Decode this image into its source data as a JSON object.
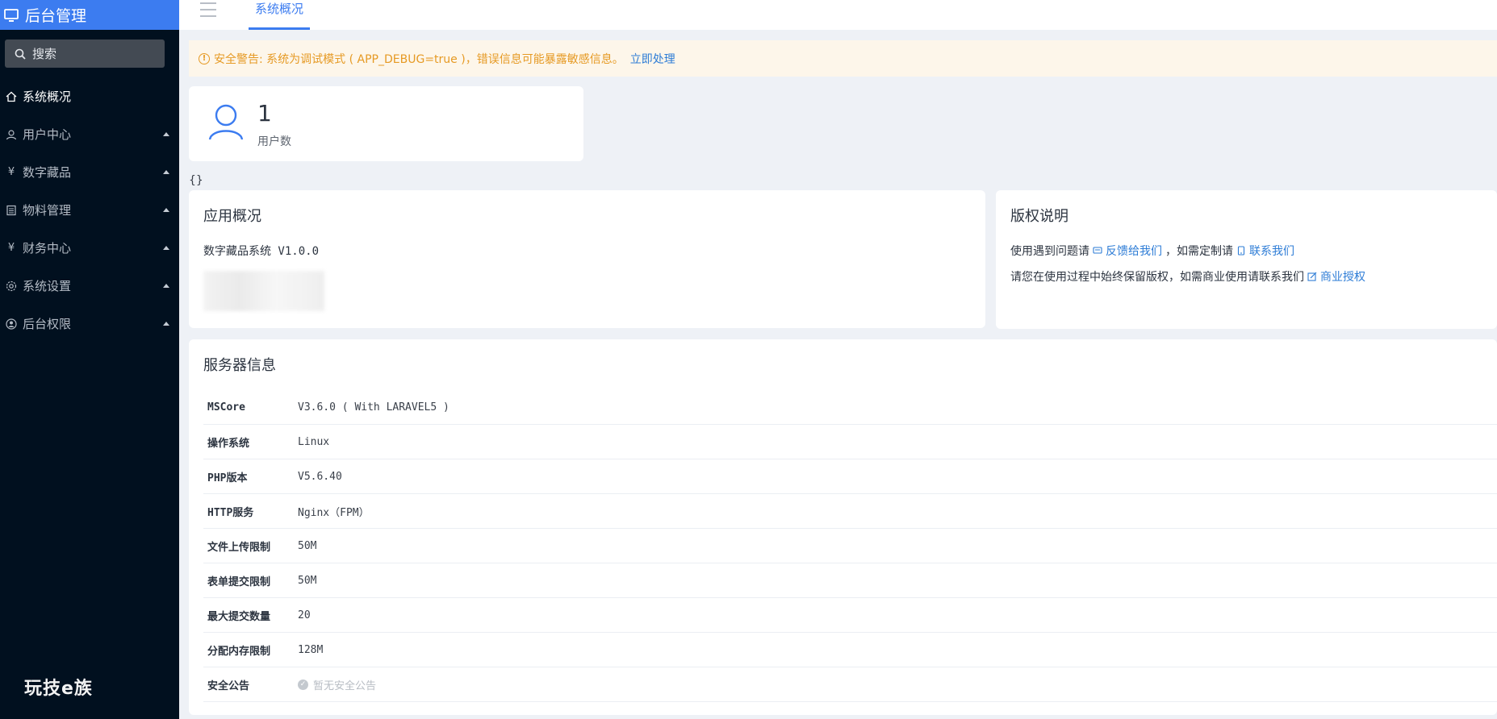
{
  "sidebar": {
    "brand_title": "后台管理",
    "search_label": "搜索",
    "items": [
      {
        "label": "系统概况",
        "icon": "home-icon",
        "active": true
      },
      {
        "label": "用户中心",
        "icon": "users-icon"
      },
      {
        "label": "数字藏品",
        "icon": "yen-icon"
      },
      {
        "label": "物料管理",
        "icon": "list-icon"
      },
      {
        "label": "财务中心",
        "icon": "yen-icon"
      },
      {
        "label": "系统设置",
        "icon": "gear-icon"
      },
      {
        "label": "后台权限",
        "icon": "user-circle-icon"
      }
    ],
    "watermark": "玩技e族"
  },
  "topbar": {
    "tab": "系统概况"
  },
  "alert": {
    "message": "安全警告: 系统为调试模式 ( APP_DEBUG=true )，错误信息可能暴露敏感信息。",
    "action": "立即处理"
  },
  "stats": {
    "user_count": "1",
    "user_label": "用户数"
  },
  "misc": {
    "braces": "{}"
  },
  "app_overview": {
    "title": "应用概况",
    "version": "数字藏品系统 V1.0.0"
  },
  "copyright": {
    "title": "版权说明",
    "line1_prefix": "使用遇到问题请",
    "line1_link1": "反馈给我们",
    "line1_mid": "，如需定制请",
    "line1_link2": "联系我们",
    "line2_prefix": "请您在使用过程中始终保留版权，如需商业使用请联系我们",
    "line2_link": "商业授权"
  },
  "server": {
    "title": "服务器信息",
    "rows": [
      {
        "key": "MSCore",
        "value": "V3.6.0 ( With LARAVEL5 )"
      },
      {
        "key": "操作系统",
        "value": "Linux"
      },
      {
        "key": "PHP版本",
        "value": "V5.6.40"
      },
      {
        "key": "HTTP服务",
        "value": "Nginx（FPM）"
      },
      {
        "key": "文件上传限制",
        "value": "50M"
      },
      {
        "key": "表单提交限制",
        "value": "50M"
      },
      {
        "key": "最大提交数量",
        "value": "20"
      },
      {
        "key": "分配内存限制",
        "value": "128M"
      },
      {
        "key": "安全公告",
        "value": "暂无安全公告"
      }
    ]
  },
  "colors": {
    "sidebar_bg": "#01101f",
    "brand_bg": "#3c7cf0",
    "accent": "#3c7cf0",
    "link": "#2d7cd6",
    "warning": "#e69a24"
  }
}
